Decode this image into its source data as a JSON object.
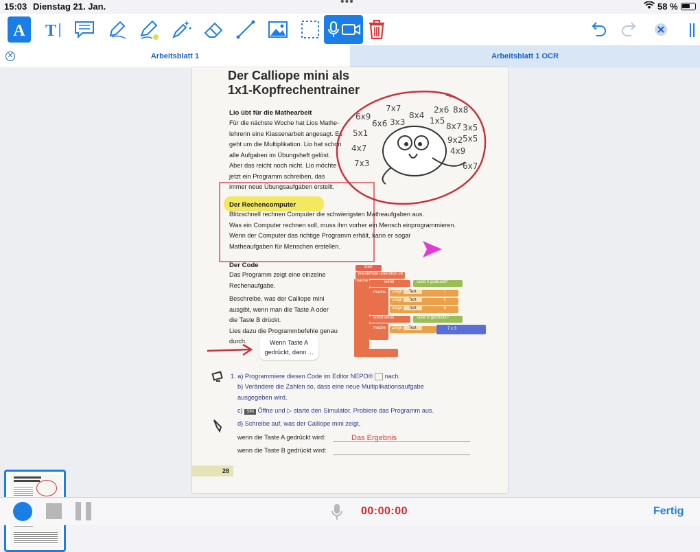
{
  "status_bar": {
    "time": "15:03",
    "date": "Dienstag 21. Jan.",
    "battery": "58 %"
  },
  "toolbar": {
    "tools": [
      {
        "name": "text-tool",
        "icon": "text-a-icon"
      },
      {
        "name": "text-field-tool",
        "icon": "text-t-icon"
      },
      {
        "name": "comment-tool",
        "icon": "speech-bubble-icon"
      },
      {
        "name": "pen-tool",
        "icon": "pen-icon"
      },
      {
        "name": "highlighter-tool",
        "icon": "highlighter-icon"
      },
      {
        "name": "magic-pen-tool",
        "icon": "magic-wand-icon"
      },
      {
        "name": "eraser-tool",
        "icon": "eraser-icon"
      },
      {
        "name": "line-tool",
        "icon": "line-icon"
      },
      {
        "name": "image-tool",
        "icon": "image-icon"
      },
      {
        "name": "selection-tool",
        "icon": "selection-icon"
      },
      {
        "name": "record-tool",
        "icon": "mic-video-icon"
      },
      {
        "name": "delete-tool",
        "icon": "trash-icon"
      }
    ],
    "accent": "#1a7ee6"
  },
  "tabs": [
    {
      "label": "Arbeitsblatt 1"
    },
    {
      "label": "Arbeitsblatt 1 OCR"
    }
  ],
  "worksheet": {
    "title_line1": "Der Calliope mini als",
    "title_line2": "1x1-Kopfrechentrainer",
    "section1_heading": "Lio übt für die Mathearbeit",
    "section1_lines": [
      "Für die nächste Woche hat Lios Mathe-",
      "lehrerin eine Klassenarbeit angesagt. Es",
      "geht um die Multiplikation. Lio hat schon",
      "alle Aufgaben im Übungsheft gelöst.",
      "Aber das reicht noch nicht. Lio möchte",
      "jetzt ein Programm schreiben, das",
      "immer neue Übungsaufgaben erstellt."
    ],
    "section2_heading": "Der Rechencomputer",
    "section2_lines": [
      "Blitzschnell rechnen Computer die schwierigsten Matheaufgaben aus.",
      "Was ein Computer rechnen soll, muss ihm vorher ein Mensch einprogrammieren.",
      "Wenn der Computer das richtige Programm erhält, kann er sogar",
      "Matheaufgaben für Menschen erstellen."
    ],
    "section3_heading": "Der Code",
    "section3_lines": [
      "Das Programm zeigt eine einzelne",
      "Rechenaufgabe."
    ],
    "section3b_lines": [
      "Beschreibe, was der Calliope mini",
      "ausgibt, wenn man die Taste A oder",
      "die Taste B drückt.",
      "Lies dazu die Programmbefehle genau",
      "durch."
    ],
    "bubble_line1": "Wenn Taste A",
    "bubble_line2": "gedrückt, dann ...",
    "task1a": "1. a) Programmiere diesen Code im Editor NEPO®",
    "task1a_suffix": "nach.",
    "task1b": "b) Verändere die Zahlen so, dass eine neue Multiplikationsaufgabe",
    "task1b_2": "ausgegeben wird.",
    "task1c_pre": "c)",
    "task1c_sim": "SIM",
    "task1c": "Öffne und",
    "task1c_2": "starte den Simulator. Probiere das Programm aus.",
    "task1d": "d) Schreibe auf, was der Calliope mini zeigt,",
    "line_a": "wenn die Taste A gedrückt wird:",
    "line_b": "wenn die Taste B gedrückt wird:",
    "page_number": "28",
    "handwritten_answer": "Das Ergebnis"
  },
  "code_blocks": {
    "start": "Start",
    "loop": "Wiederhole unendlich oft",
    "do": "mache",
    "if": "wenn",
    "button_a": "Taste  A",
    "pressed": "gedrückt?",
    "show": "Zeige",
    "text": "Text",
    "num1": "7",
    "num2": "x",
    "num3": "3",
    "else_if": "sonst wenn",
    "button_b": "Taste  B",
    "mult": "7  x  3"
  },
  "annotations": {
    "ink_red": "#c8323c",
    "highlight": "#f3e330",
    "arrow_magenta": "#e23ad6"
  },
  "bottom_bar": {
    "timer": "00:00:00",
    "done": "Fertig"
  }
}
